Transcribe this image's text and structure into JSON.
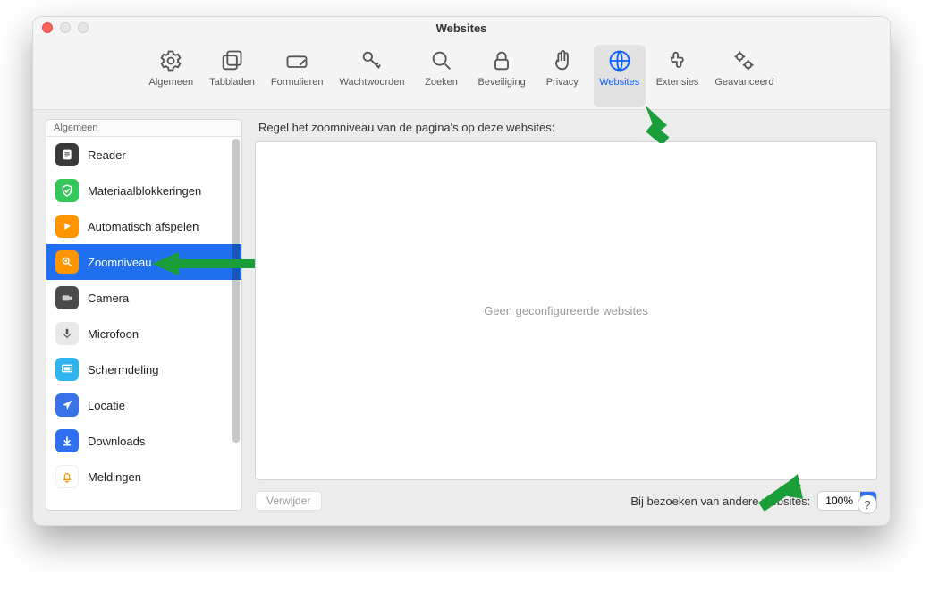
{
  "window": {
    "title": "Websites"
  },
  "toolbar": {
    "items": [
      {
        "label": "Algemeen"
      },
      {
        "label": "Tabbladen"
      },
      {
        "label": "Formulieren"
      },
      {
        "label": "Wachtwoorden"
      },
      {
        "label": "Zoeken"
      },
      {
        "label": "Beveiliging"
      },
      {
        "label": "Privacy"
      },
      {
        "label": "Websites"
      },
      {
        "label": "Extensies"
      },
      {
        "label": "Geavanceerd"
      }
    ]
  },
  "sidebar": {
    "header": "Algemeen",
    "items": [
      {
        "label": "Reader"
      },
      {
        "label": "Materiaalblokkeringen"
      },
      {
        "label": "Automatisch afspelen"
      },
      {
        "label": "Zoomniveau"
      },
      {
        "label": "Camera"
      },
      {
        "label": "Microfoon"
      },
      {
        "label": "Schermdeling"
      },
      {
        "label": "Locatie"
      },
      {
        "label": "Downloads"
      },
      {
        "label": "Meldingen"
      }
    ]
  },
  "main": {
    "title": "Regel het zoomniveau van de pagina's op deze websites:",
    "empty": "Geen geconfigureerde websites",
    "remove": "Verwijder",
    "footer_label": "Bij bezoeken van andere websites:",
    "select_value": "100%"
  },
  "help": "?"
}
